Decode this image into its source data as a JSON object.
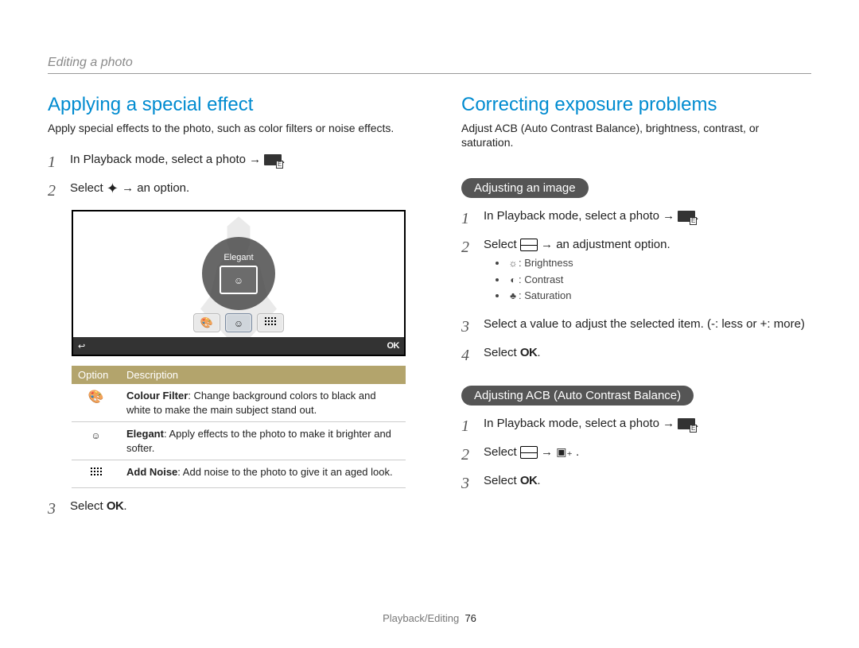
{
  "running_head": "Editing a photo",
  "footer_section": "Playback/Editing",
  "footer_page": "76",
  "arrow": "→",
  "left": {
    "title": "Applying a special effect",
    "intro": "Apply special effects to the photo, such as color filters or noise effects.",
    "steps": {
      "s1_a": "In Playback mode, select a photo ",
      "s1_b": ".",
      "s2_a": "Select ",
      "s2_b": " an option.",
      "s3_a": "Select ",
      "s3_b": "."
    },
    "screenshot": {
      "label": "Elegant",
      "btn_back": "↩",
      "btn_ok": "OK"
    },
    "table": {
      "h_option": "Option",
      "h_desc": "Description",
      "rows": [
        {
          "icon": "palette-icon",
          "icon_glyph": "🎨",
          "name": "Colour Filter",
          "desc": ": Change background colors to black and white to make the main subject stand out."
        },
        {
          "icon": "elegant-icon",
          "icon_glyph": "☺",
          "name": "Elegant",
          "desc": ": Apply effects to the photo to make it brighter and softer."
        },
        {
          "icon": "noise-icon",
          "icon_glyph": "▦",
          "name": "Add Noise",
          "desc": ": Add noise to the photo to give it an aged look."
        }
      ]
    },
    "ok_label": "OK"
  },
  "right": {
    "title": "Correcting exposure problems",
    "intro": "Adjust ACB (Auto Contrast Balance), brightness, contrast, or saturation.",
    "sub1_title": "Adjusting an image",
    "sub1": {
      "s1_a": "In Playback mode, select a photo ",
      "s1_b": ".",
      "s2_a": "Select ",
      "s2_b": " an adjustment option.",
      "bullets": [
        {
          "glyph": "☼",
          "label": ": Brightness"
        },
        {
          "glyph": "◐",
          "label": ": Contrast"
        },
        {
          "glyph": "♣",
          "label": ": Saturation"
        }
      ],
      "s3": "Select a value to adjust the selected item. (-: less or +: more)",
      "s4_a": "Select ",
      "s4_b": "."
    },
    "sub2_title": "Adjusting ACB (Auto Contrast Balance)",
    "sub2": {
      "s1_a": "In Playback mode, select a photo ",
      "s1_b": ".",
      "s2_a": "Select ",
      "s2_b": " .",
      "s3_a": "Select ",
      "s3_b": "."
    },
    "ok_label": "OK"
  }
}
